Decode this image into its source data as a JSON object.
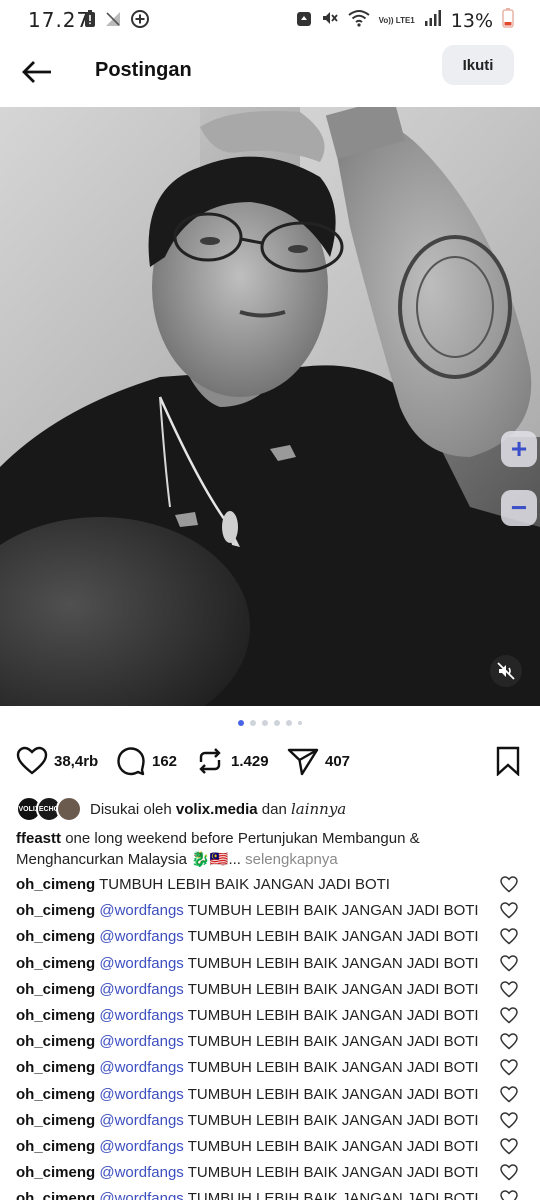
{
  "status_bar": {
    "time": "17.27",
    "battery_percent": "13%",
    "network": "Vo)) LTE1",
    "icons": [
      "battery-alert-icon",
      "no-signal-icon",
      "add-circle-icon",
      "recycle-icon",
      "mute-icon",
      "wifi-icon",
      "lte-icon",
      "signal-icon",
      "battery-icon"
    ]
  },
  "header": {
    "title": "Postingan",
    "follow_label": "Ikuti"
  },
  "post": {
    "carousel_total": 6,
    "carousel_active": 1,
    "zoom_in": "+",
    "zoom_out": "−"
  },
  "actions": {
    "likes": "38,4rb",
    "comments": "162",
    "reposts": "1.429",
    "shares": "407"
  },
  "liked_by": {
    "prefix": "Disukai oleh",
    "user": "volix.media",
    "connector": "dan",
    "others": "lainnya",
    "avatar1_text": "VOLIX",
    "avatar2_text": "ECHO"
  },
  "caption": {
    "username": "ffeastt",
    "text": "one long weekend before Pertunjukan Membangun & Menghancurkan Malaysia 🐉🇲🇾...",
    "more": "selengkapnya"
  },
  "comments": [
    {
      "user": "oh_cimeng",
      "mention": "",
      "text": "TUMBUH LEBIH BAIK JANGAN JADI BOTI"
    },
    {
      "user": "oh_cimeng",
      "mention": "@wordfangs",
      "text": "TUMBUH LEBIH BAIK JANGAN JADI BOTI"
    },
    {
      "user": "oh_cimeng",
      "mention": "@wordfangs",
      "text": "TUMBUH LEBIH BAIK JANGAN JADI BOTI"
    },
    {
      "user": "oh_cimeng",
      "mention": "@wordfangs",
      "text": "TUMBUH LEBIH BAIK JANGAN JADI BOTI"
    },
    {
      "user": "oh_cimeng",
      "mention": "@wordfangs",
      "text": "TUMBUH LEBIH BAIK JANGAN JADI BOTI"
    },
    {
      "user": "oh_cimeng",
      "mention": "@wordfangs",
      "text": "TUMBUH LEBIH BAIK JANGAN JADI BOTI"
    },
    {
      "user": "oh_cimeng",
      "mention": "@wordfangs",
      "text": "TUMBUH LEBIH BAIK JANGAN JADI BOTI"
    },
    {
      "user": "oh_cimeng",
      "mention": "@wordfangs",
      "text": "TUMBUH LEBIH BAIK JANGAN JADI BOTI"
    },
    {
      "user": "oh_cimeng",
      "mention": "@wordfangs",
      "text": "TUMBUH LEBIH BAIK JANGAN JADI BOTI"
    },
    {
      "user": "oh_cimeng",
      "mention": "@wordfangs",
      "text": "TUMBUH LEBIH BAIK JANGAN JADI BOTI"
    },
    {
      "user": "oh_cimeng",
      "mention": "@wordfangs",
      "text": "TUMBUH LEBIH BAIK JANGAN JADI BOTI"
    },
    {
      "user": "oh_cimeng",
      "mention": "@wordfangs",
      "text": "TUMBUH LEBIH BAIK JANGAN JADI BOTI"
    },
    {
      "user": "oh_cimeng",
      "mention": "@wordfangs",
      "text": "TUMBUH LEBIH BAIK JANGAN JADI BOTI"
    }
  ],
  "colors": {
    "accent": "#4a64e6",
    "mention": "#3d4fc0",
    "follow_bg": "#eceef1"
  }
}
